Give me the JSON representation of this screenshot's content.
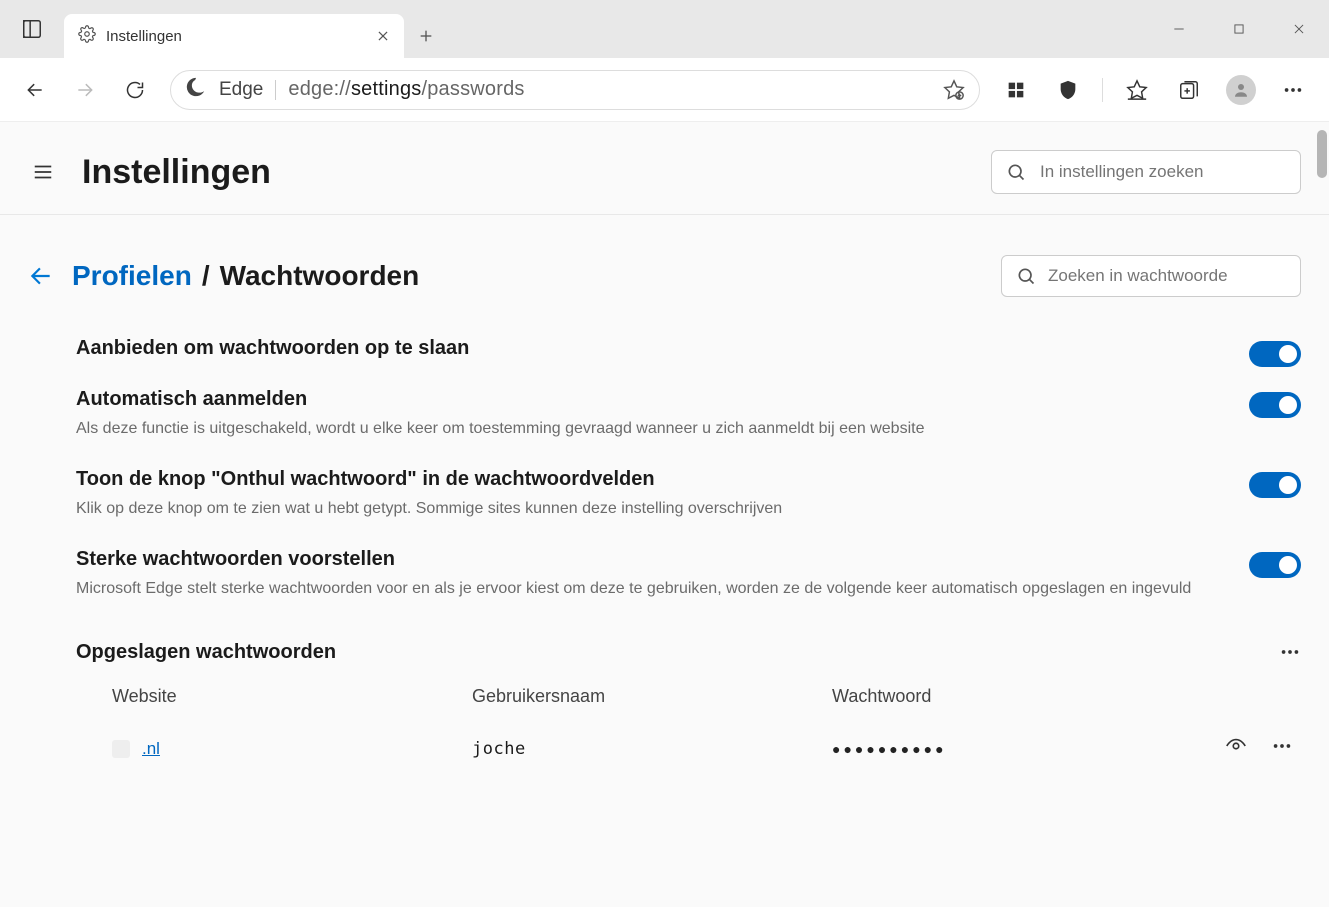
{
  "tab": {
    "title": "Instellingen"
  },
  "address": {
    "brand": "Edge",
    "url_prefix": "edge://",
    "url_mid": "settings",
    "url_suffix": "/passwords"
  },
  "settings_header": {
    "title": "Instellingen",
    "search_placeholder": "In instellingen zoeken"
  },
  "breadcrumb": {
    "link": "Profielen",
    "slash": "/",
    "current": "Wachtwoorden"
  },
  "password_search": {
    "placeholder": "Zoeken in wachtwoorde"
  },
  "options": [
    {
      "title": "Aanbieden om wachtwoorden op te slaan",
      "desc": null,
      "on": true
    },
    {
      "title": "Automatisch aanmelden",
      "desc": "Als deze functie is uitgeschakeld, wordt u elke keer om toestemming gevraagd wanneer u zich aanmeldt bij een website",
      "on": true
    },
    {
      "title": "Toon de knop \"Onthul wachtwoord\" in de wachtwoordvelden",
      "desc": "Klik op deze knop om te zien wat u hebt getypt. Sommige sites kunnen deze instelling overschrijven",
      "on": true
    },
    {
      "title": "Sterke wachtwoorden voorstellen",
      "desc": "Microsoft Edge stelt sterke wachtwoorden voor en als je ervoor kiest om deze te gebruiken, worden ze de volgende keer automatisch opgeslagen en ingevuld",
      "on": true
    }
  ],
  "saved_section": {
    "title": "Opgeslagen wachtwoorden",
    "columns": {
      "website": "Website",
      "user": "Gebruikersnaam",
      "password": "Wachtwoord"
    },
    "rows": [
      {
        "site": ".nl",
        "user": "joche",
        "password": "●●●●●●●●●●"
      }
    ]
  }
}
